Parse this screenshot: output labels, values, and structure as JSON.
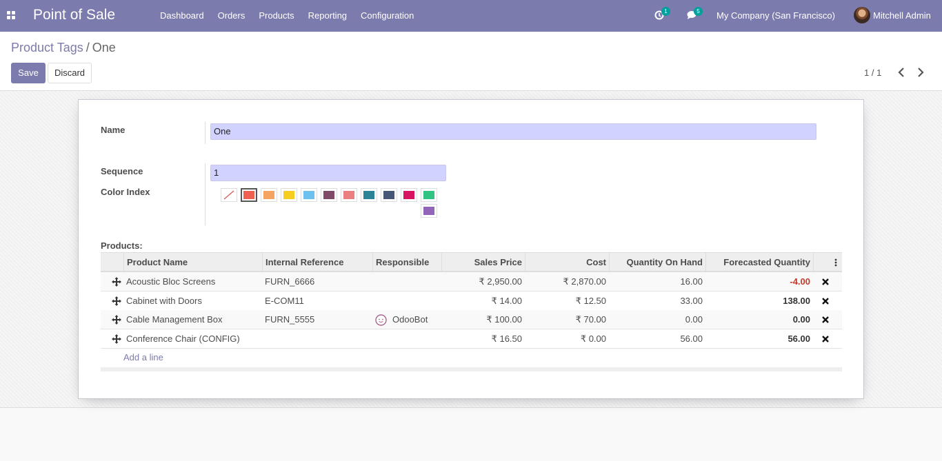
{
  "navbar": {
    "app_title": "Point of Sale",
    "menu": [
      {
        "label": "Dashboard"
      },
      {
        "label": "Orders"
      },
      {
        "label": "Products"
      },
      {
        "label": "Reporting"
      },
      {
        "label": "Configuration"
      }
    ],
    "activity_count": "1",
    "messages_count": "5",
    "company": "My Company (San Francisco)",
    "user": "Mitchell Admin"
  },
  "breadcrumb": {
    "parent": "Product Tags",
    "separator": "/",
    "current": "One"
  },
  "buttons": {
    "save": "Save",
    "discard": "Discard"
  },
  "pager": {
    "value": "1 / 1"
  },
  "form": {
    "name_label": "Name",
    "name_value": "One",
    "sequence_label": "Sequence",
    "sequence_value": "1",
    "color_label": "Color Index",
    "colors": [
      "none",
      "#f06050",
      "#f4a460",
      "#f7cd1f",
      "#6cc1ed",
      "#814968",
      "#eb7e7f",
      "#2c8397",
      "#475577",
      "#d6145f",
      "#30c381",
      "#9365b8"
    ],
    "selected_color_index": 1
  },
  "products": {
    "section_label": "Products:",
    "columns": [
      {
        "label": "Product Name"
      },
      {
        "label": "Internal Reference"
      },
      {
        "label": "Responsible"
      },
      {
        "label": "Sales Price"
      },
      {
        "label": "Cost"
      },
      {
        "label": "Quantity On Hand"
      },
      {
        "label": "Forecasted Quantity"
      }
    ],
    "rows": [
      {
        "name": "Acoustic Bloc Screens",
        "ref": "FURN_6666",
        "responsible": "",
        "price": "₹ 2,950.00",
        "cost": "₹ 2,870.00",
        "on_hand": "16.00",
        "forecast": "-4.00"
      },
      {
        "name": "Cabinet with Doors",
        "ref": "E-COM11",
        "responsible": "",
        "price": "₹ 14.00",
        "cost": "₹ 12.50",
        "on_hand": "33.00",
        "forecast": "138.00"
      },
      {
        "name": "Cable Management Box",
        "ref": "FURN_5555",
        "responsible": "OdooBot",
        "price": "₹ 100.00",
        "cost": "₹ 70.00",
        "on_hand": "0.00",
        "forecast": "0.00"
      },
      {
        "name": "Conference Chair (CONFIG)",
        "ref": "",
        "responsible": "",
        "price": "₹ 16.50",
        "cost": "₹ 0.00",
        "on_hand": "56.00",
        "forecast": "56.00"
      }
    ],
    "add_line": "Add a line"
  }
}
